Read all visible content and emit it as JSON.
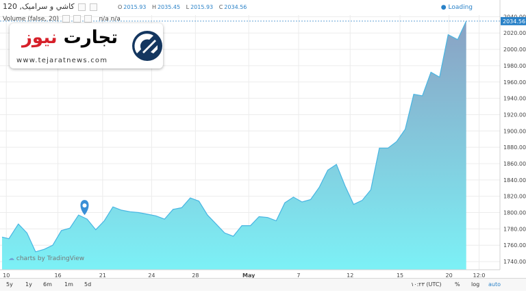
{
  "header": {
    "symbol_title": "کاشي و سراميک, 120",
    "ohlc": [
      {
        "key": "O",
        "value": "2015.93"
      },
      {
        "key": "H",
        "value": "2035.45"
      },
      {
        "key": "L",
        "value": "2015.93"
      },
      {
        "key": "C",
        "value": "2034.56"
      }
    ],
    "loading": "Loading"
  },
  "study": {
    "label": "Volume (false, 20)",
    "value1": "n/a",
    "value2": "n/a"
  },
  "watermark": {
    "name_part1": "تجارت",
    "name_part2": "نیوز",
    "url": "www.tejaratnews.com"
  },
  "attribution": "charts by TradingView",
  "chart_data": {
    "type": "area",
    "ylim": [
      1730,
      2042
    ],
    "yticks": [
      1740,
      1760,
      1780,
      1800,
      1820,
      1840,
      1860,
      1880,
      1900,
      1920,
      1940,
      1960,
      1980,
      2000,
      2020,
      2040
    ],
    "xlim": [
      0,
      56
    ],
    "xticks": [
      {
        "pos": 0.5,
        "label": "10"
      },
      {
        "pos": 6.5,
        "label": "16"
      },
      {
        "pos": 11.7,
        "label": "21"
      },
      {
        "pos": 17.4,
        "label": "24"
      },
      {
        "pos": 22.5,
        "label": "28"
      },
      {
        "pos": 28.7,
        "label": "May"
      },
      {
        "pos": 34.5,
        "label": "7"
      },
      {
        "pos": 40.5,
        "label": "12"
      },
      {
        "pos": 46.3,
        "label": "15"
      },
      {
        "pos": 52.0,
        "label": "20"
      },
      {
        "pos": 55.5,
        "label": "12:0"
      }
    ],
    "last_value_label": "2034.56",
    "x": [
      0,
      0.8,
      1.9,
      2.9,
      3.9,
      4.9,
      5.9,
      6.9,
      7.9,
      8.9,
      9.9,
      10.9,
      11.9,
      12.9,
      13.9,
      14.9,
      15.9,
      16.9,
      17.9,
      18.9,
      19.9,
      20.9,
      21.9,
      22.9,
      23.9,
      24.9,
      25.9,
      26.9,
      27.9,
      28.9,
      29.9,
      30.9,
      31.9,
      32.9,
      33.9,
      34.9,
      35.9,
      36.9,
      37.9,
      38.9,
      39.9,
      40.9,
      41.9,
      42.9,
      43.9,
      44.9,
      45.9,
      46.9,
      47.9,
      48.9,
      49.9,
      50.9,
      51.9
    ],
    "values": [
      1770,
      1768,
      1786,
      1775,
      1752,
      1755,
      1760,
      1778,
      1781,
      1797,
      1792,
      1779,
      1790,
      1807,
      1803,
      1801,
      1800,
      1798,
      1796,
      1792,
      1804,
      1806,
      1818,
      1814,
      1797,
      1786,
      1775,
      1771,
      1784,
      1784,
      1795,
      1794,
      1790,
      1812,
      1819,
      1813,
      1816,
      1831,
      1852,
      1859,
      1833,
      1810,
      1815,
      1828,
      1879,
      1879,
      1887,
      1902,
      1945,
      1943,
      1972,
      1966,
      2018,
      2012,
      2034.56
    ],
    "marker": {
      "x": 9.6,
      "y": 1797
    }
  },
  "bottom_bar": {
    "ranges": [
      "5y",
      "1y",
      "6m",
      "1m",
      "5d"
    ],
    "time": "۱۰:۲۳ (UTC)",
    "percent": "%",
    "log": "log",
    "auto": "auto"
  },
  "colors": {
    "line": "#47b5e2",
    "fill_top": "#8aa1c3",
    "fill_bottom": "#7cf1f6",
    "accent": "#2a82c8",
    "brand_red": "#d6202a"
  }
}
